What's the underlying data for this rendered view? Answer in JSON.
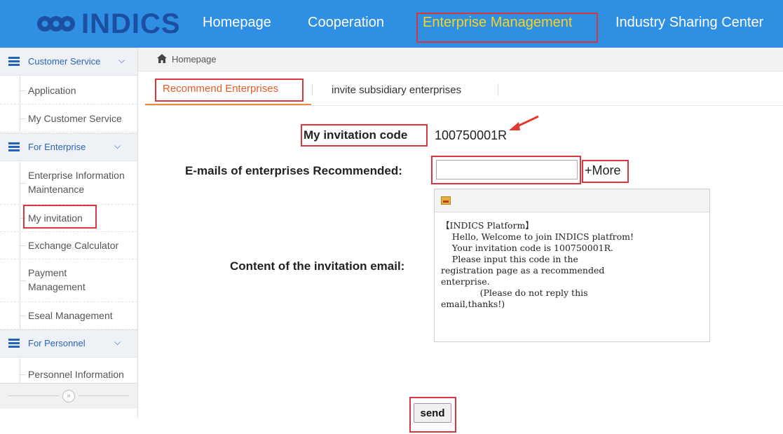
{
  "brand": {
    "logo_text": "INDICS"
  },
  "nav": {
    "items": [
      {
        "label": "Homepage"
      },
      {
        "label": "Cooperation"
      },
      {
        "label": "Enterprise Management"
      },
      {
        "label": "Industry Sharing Center"
      }
    ],
    "active_index": 2,
    "active_color": "#f5d327",
    "bar_color": "#2e8fe3"
  },
  "sidebar": {
    "groups": [
      {
        "label": "Customer Service",
        "items": [
          {
            "label": "Application"
          },
          {
            "label": "My Customer Service"
          }
        ]
      },
      {
        "label": "For Enterprise",
        "items": [
          {
            "label": "Enterprise Information Maintenance"
          },
          {
            "label": "My invitation"
          },
          {
            "label": "Exchange Calculator"
          },
          {
            "label": "Payment Management"
          },
          {
            "label": "Eseal Management"
          }
        ]
      },
      {
        "label": "For Personnel",
        "items": [
          {
            "label": "Personnel Information"
          }
        ]
      }
    ],
    "collapse_icon": "double-chevron-right-icon"
  },
  "breadcrumb": {
    "home_label": "Homepage",
    "icon": "home-icon"
  },
  "tabs": [
    {
      "label": "Recommend Enterprises",
      "active": true
    },
    {
      "label": "invite subsidiary enterprises",
      "active": false
    }
  ],
  "form": {
    "invitation_code_label": "My invitation code",
    "invitation_code_value": "100750001R",
    "emails_label": "E-mails of enterprises Recommended:",
    "emails_value": "",
    "more_label": "+More",
    "content_label": "Content of the invitation email:",
    "email_content": "【INDICS Platform】\n    Hello, Welcome to join INDICS platfrom!\n    Your invitation code is 100750001R.\n    Please input this code in the\nregistration page as a recommended\nenterprise.\n              (Please do not reply this\nemail,thanks!)",
    "send_label": "send"
  },
  "highlight_color": "#d9363e"
}
